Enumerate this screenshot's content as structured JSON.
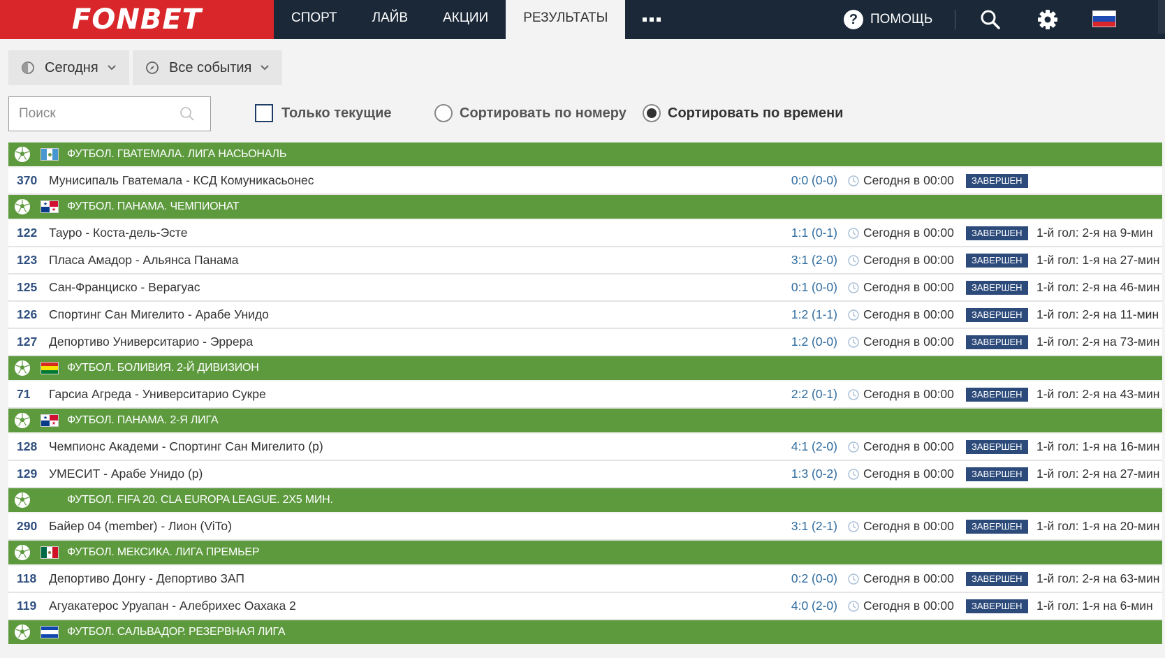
{
  "brand": "FONBET",
  "nav": {
    "tabs": [
      "СПОРТ",
      "ЛАЙВ",
      "АКЦИИ",
      "РЕЗУЛЬТАТЫ"
    ],
    "active": "РЕЗУЛЬТАТЫ"
  },
  "header": {
    "help_label": "ПОМОЩЬ"
  },
  "filters": {
    "date_label": "Сегодня",
    "events_label": "Все события",
    "search_placeholder": "Поиск",
    "only_current": "Только текущие",
    "sort_by_number": "Сортировать по номеру",
    "sort_by_time": "Сортировать по времени"
  },
  "colors": {
    "brand_red": "#d8262a",
    "header_bg": "#1b2838",
    "league_green": "#5d9a3e",
    "status_blue": "#2c4a7a",
    "score_blue": "#2e6b9e"
  },
  "leagues": [
    {
      "name": "ФУТБОЛ. ГВАТЕМАЛА. ЛИГА НАСЬОНАЛЬ",
      "flag": "guatemala",
      "matches": [
        {
          "num": "370",
          "teams": "Мунисипаль Гватемала - КСД Комуникасьонес",
          "score": "0:0 (0-0)",
          "time": "Сегодня в 00:00",
          "status": "ЗАВЕРШЕН",
          "goal": ""
        }
      ]
    },
    {
      "name": "ФУТБОЛ. ПАНАМА. ЧЕМПИОНАТ",
      "flag": "panama",
      "matches": [
        {
          "num": "122",
          "teams": "Тауро - Коста-дель-Эсте",
          "score": "1:1 (0-1)",
          "time": "Сегодня в 00:00",
          "status": "ЗАВЕРШЕН",
          "goal": "1-й гол: 2-я на 9-мин"
        },
        {
          "num": "123",
          "teams": "Пласа Амадор - Альянса Панама",
          "score": "3:1 (2-0)",
          "time": "Сегодня в 00:00",
          "status": "ЗАВЕРШЕН",
          "goal": "1-й гол: 1-я на 27-мин"
        },
        {
          "num": "125",
          "teams": "Сан-Франциско - Верагуас",
          "score": "0:1 (0-0)",
          "time": "Сегодня в 00:00",
          "status": "ЗАВЕРШЕН",
          "goal": "1-й гол: 2-я на 46-мин"
        },
        {
          "num": "126",
          "teams": "Спортинг Сан Мигелито - Арабе Унидо",
          "score": "1:2 (1-1)",
          "time": "Сегодня в 00:00",
          "status": "ЗАВЕРШЕН",
          "goal": "1-й гол: 2-я на 11-мин"
        },
        {
          "num": "127",
          "teams": "Депортиво Университарио - Эррера",
          "score": "1:2 (0-0)",
          "time": "Сегодня в 00:00",
          "status": "ЗАВЕРШЕН",
          "goal": "1-й гол: 2-я на 73-мин"
        }
      ]
    },
    {
      "name": "ФУТБОЛ. БОЛИВИЯ. 2-Й ДИВИЗИОН",
      "flag": "bolivia",
      "matches": [
        {
          "num": "71",
          "teams": "Гарсиа Агреда - Университарио Сукре",
          "score": "2:2 (0-1)",
          "time": "Сегодня в 00:00",
          "status": "ЗАВЕРШЕН",
          "goal": "1-й гол: 2-я на 43-мин"
        }
      ]
    },
    {
      "name": "ФУТБОЛ. ПАНАМА. 2-Я ЛИГА",
      "flag": "panama",
      "matches": [
        {
          "num": "128",
          "teams": "Чемпионс Академи - Спортинг Сан Мигелито (р)",
          "score": "4:1 (2-0)",
          "time": "Сегодня в 00:00",
          "status": "ЗАВЕРШЕН",
          "goal": "1-й гол: 1-я на 16-мин"
        },
        {
          "num": "129",
          "teams": "УМЕСИТ - Арабе Унидо (р)",
          "score": "1:3 (0-2)",
          "time": "Сегодня в 00:00",
          "status": "ЗАВЕРШЕН",
          "goal": "1-й гол: 2-я на 27-мин"
        }
      ]
    },
    {
      "name": "ФУТБОЛ. FIFA 20. CLA EUROPA LEAGUE. 2X5 МИН.",
      "flag": "none",
      "matches": [
        {
          "num": "290",
          "teams": "Байер 04 (member) - Лион (ViTo)",
          "score": "3:1 (2-1)",
          "time": "Сегодня в 00:00",
          "status": "ЗАВЕРШЕН",
          "goal": "1-й гол: 1-я на 20-мин"
        }
      ]
    },
    {
      "name": "ФУТБОЛ. МЕКСИКА. ЛИГА ПРЕМЬЕР",
      "flag": "mexico",
      "matches": [
        {
          "num": "118",
          "teams": "Депортиво Донгу - Депортиво ЗАП",
          "score": "0:2 (0-0)",
          "time": "Сегодня в 00:00",
          "status": "ЗАВЕРШЕН",
          "goal": "1-й гол: 2-я на 63-мин"
        },
        {
          "num": "119",
          "teams": "Агуакатерос Уруапан - Алебрихес Оахака 2",
          "score": "4:0 (2-0)",
          "time": "Сегодня в 00:00",
          "status": "ЗАВЕРШЕН",
          "goal": "1-й гол: 1-я на 6-мин"
        }
      ]
    },
    {
      "name": "ФУТБОЛ. САЛЬВАДОР. РЕЗЕРВНАЯ ЛИГА",
      "flag": "salvador",
      "matches": []
    }
  ]
}
